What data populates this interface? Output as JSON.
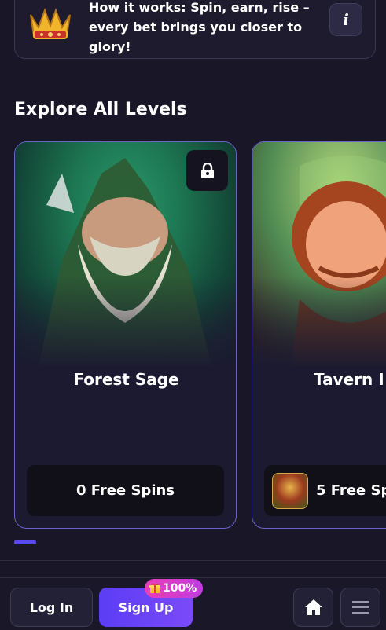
{
  "info": {
    "text": "How it works: Spin, earn, rise – every bet brings you closer to glory!",
    "info_icon": "i"
  },
  "section_title": "Explore All Levels",
  "levels": [
    {
      "title": "Forest Sage",
      "spins": "0 Free Spins",
      "locked": true,
      "icon": "lock-icon"
    },
    {
      "title": "Tavern I",
      "spins": "5 Free Sp",
      "locked": false,
      "icon": "game-thumbnail"
    }
  ],
  "carousel": {
    "active_index": 0
  },
  "bottom_bar": {
    "login": "Log In",
    "signup": "Sign Up",
    "bonus": "100%",
    "home_icon": "home-icon",
    "menu_icon": "menu-icon"
  },
  "colors": {
    "background": "#181627",
    "accent": "#5b3df5",
    "card_border": "#6b63c9",
    "bonus": "#e83fb6"
  }
}
